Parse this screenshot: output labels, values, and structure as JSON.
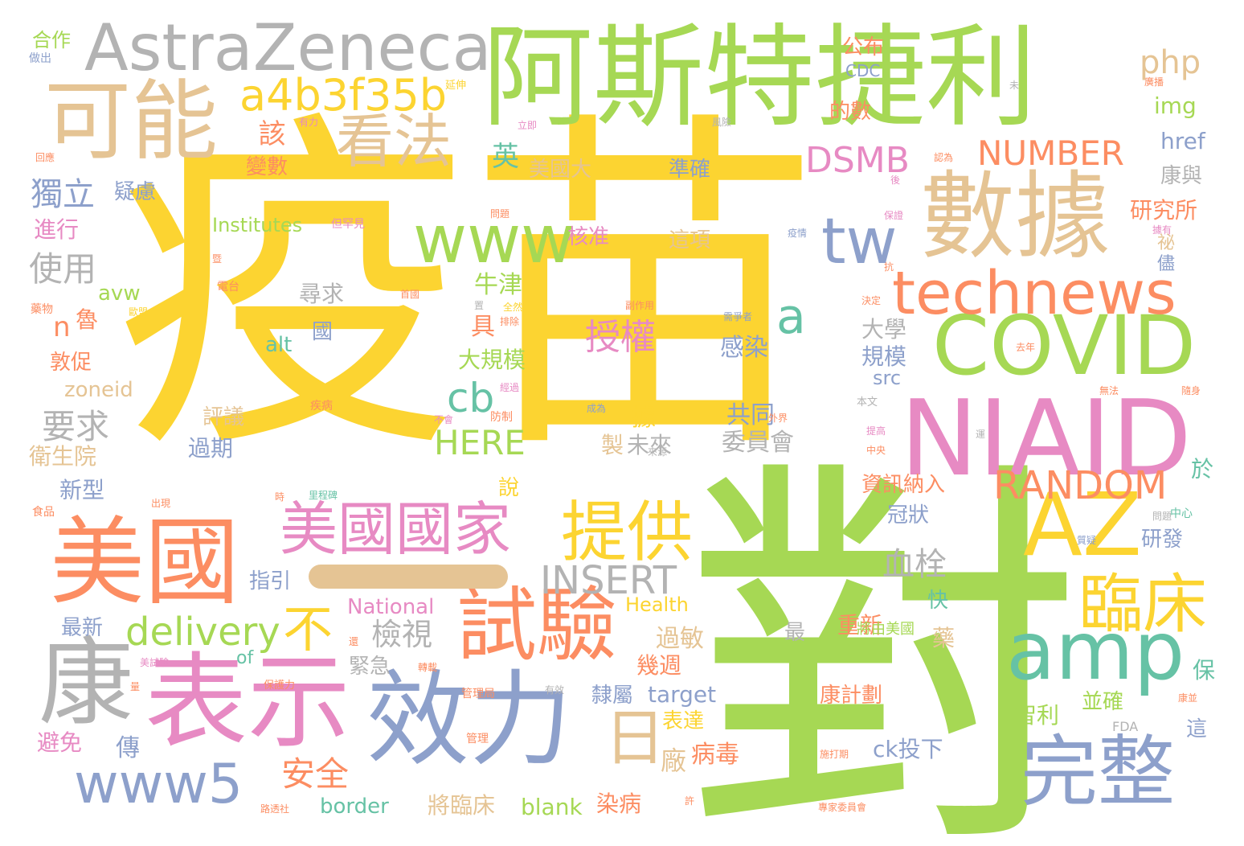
{
  "background": "#ffffff",
  "palette": {
    "yellow": "#fcd431",
    "green": "#a6d854",
    "orange": "#fc8d62",
    "blue": "#8da0cb",
    "pink": "#e78ac3",
    "tan": "#e5c494",
    "gray": "#b3b3b3",
    "teal": "#66c2a5"
  },
  "words": [
    {
      "id": "yimiao",
      "text": "疫苗",
      "color": "#fcd431"
    },
    {
      "id": "dui",
      "text": "對",
      "color": "#a6d854"
    },
    {
      "id": "astelijie",
      "text": "阿斯特捷利",
      "color": "#a6d854"
    },
    {
      "id": "astrazeneca",
      "text": "AstraZeneca",
      "color": "#b3b3b3"
    },
    {
      "id": "keneng",
      "text": "可能",
      "color": "#e5c494"
    },
    {
      "id": "kanfa",
      "text": "看法",
      "color": "#e5c494"
    },
    {
      "id": "a4b",
      "text": "a4b3f35b",
      "color": "#fcd431"
    },
    {
      "id": "shuju",
      "text": "數據",
      "color": "#e5c494"
    },
    {
      "id": "niaid",
      "text": "NIAID",
      "color": "#e78ac3"
    },
    {
      "id": "covid",
      "text": "COVID",
      "color": "#a6d854"
    },
    {
      "id": "technews",
      "text": "technews",
      "color": "#fc8d62"
    },
    {
      "id": "www",
      "text": "www",
      "color": "#a6d854"
    },
    {
      "id": "tw",
      "text": "tw",
      "color": "#8da0cb"
    },
    {
      "id": "az",
      "text": "AZ",
      "color": "#fcd431"
    },
    {
      "id": "amp",
      "text": "amp",
      "color": "#66c2a5"
    },
    {
      "id": "meiguo",
      "text": "美國",
      "color": "#fc8d62"
    },
    {
      "id": "biaoshi",
      "text": "表示",
      "color": "#e78ac3"
    },
    {
      "id": "xiaoli",
      "text": "效力",
      "color": "#8da0cb"
    },
    {
      "id": "shiyan",
      "text": "試驗",
      "color": "#fc8d62"
    },
    {
      "id": "kang",
      "text": "康",
      "color": "#b3b3b3"
    },
    {
      "id": "wanzheng",
      "text": "完整",
      "color": "#8da0cb"
    },
    {
      "id": "linchuang",
      "text": "臨床",
      "color": "#fcd431"
    },
    {
      "id": "tigong",
      "text": "提供",
      "color": "#fcd431"
    },
    {
      "id": "meiguoguojia",
      "text": "美國國家",
      "color": "#e78ac3"
    },
    {
      "id": "www5",
      "text": "www5",
      "color": "#8da0cb"
    },
    {
      "id": "ri",
      "text": "日",
      "color": "#e5c494"
    },
    {
      "id": "dsmb",
      "text": "DSMB",
      "color": "#e78ac3"
    },
    {
      "id": "number",
      "text": "NUMBER",
      "color": "#fc8d62"
    },
    {
      "id": "random",
      "text": "RANDOM",
      "color": "#fc8d62"
    },
    {
      "id": "insert",
      "text": "INSERT",
      "color": "#b3b3b3"
    },
    {
      "id": "delivery",
      "text": "delivery",
      "color": "#a6d854"
    },
    {
      "id": "here",
      "text": "HERE",
      "color": "#a6d854"
    },
    {
      "id": "php",
      "text": "php",
      "color": "#e5c494"
    },
    {
      "id": "a",
      "text": "a",
      "color": "#66c2a5"
    },
    {
      "id": "cb",
      "text": "cb",
      "color": "#66c2a5"
    },
    {
      "id": "bu",
      "text": "不",
      "color": "#fcd431"
    },
    {
      "id": "dashline",
      "text": "一",
      "color": "#e5c494"
    },
    {
      "id": "shouquan",
      "text": "授權",
      "color": "#e78ac3"
    },
    {
      "id": "duli",
      "text": "獨立",
      "color": "#8da0cb"
    },
    {
      "id": "shiyong",
      "text": "使用",
      "color": "#b3b3b3"
    },
    {
      "id": "yaoqiu",
      "text": "要求",
      "color": "#b3b3b3"
    },
    {
      "id": "jianshi",
      "text": "檢視",
      "color": "#b3b3b3"
    },
    {
      "id": "anquan",
      "text": "安全",
      "color": "#fc8d62"
    },
    {
      "id": "xueshuan",
      "text": "血栓",
      "color": "#b3b3b3"
    },
    {
      "id": "gai",
      "text": "該",
      "color": "#fc8d62"
    },
    {
      "id": "yilv",
      "text": "疑慮",
      "color": "#8da0cb"
    },
    {
      "id": "jinxing",
      "text": "進行",
      "color": "#e78ac3"
    },
    {
      "id": "bianshu",
      "text": "變數",
      "color": "#fc8d62"
    },
    {
      "id": "meiguoda",
      "text": "美國大",
      "color": "#e5c494"
    },
    {
      "id": "ying",
      "text": "英",
      "color": "#66c2a5"
    },
    {
      "id": "zhunque",
      "text": "準確",
      "color": "#8da0cb"
    },
    {
      "id": "zhexiang",
      "text": "這項",
      "color": "#e5c494"
    },
    {
      "id": "hezhun",
      "text": "核准",
      "color": "#e78ac3"
    },
    {
      "id": "niujin",
      "text": "牛津",
      "color": "#a6d854"
    },
    {
      "id": "xunqiu",
      "text": "尋求",
      "color": "#b3b3b3"
    },
    {
      "id": "daxue",
      "text": "大學",
      "color": "#b3b3b3"
    },
    {
      "id": "guimo",
      "text": "規模",
      "color": "#8da0cb"
    },
    {
      "id": "daguimo",
      "text": "大規模",
      "color": "#a6d854"
    },
    {
      "id": "ganran",
      "text": "感染",
      "color": "#8da0cb"
    },
    {
      "id": "gongtong",
      "text": "共同",
      "color": "#8da0cb"
    },
    {
      "id": "weiyuanhui",
      "text": "委員會",
      "color": "#b3b3b3"
    },
    {
      "id": "weilai",
      "text": "未來",
      "color": "#b3b3b3"
    },
    {
      "id": "zhi",
      "text": "製",
      "color": "#e5c494"
    },
    {
      "id": "ju",
      "text": "據",
      "color": "#fcd431"
    },
    {
      "id": "guoqi",
      "text": "過期",
      "color": "#8da0cb"
    },
    {
      "id": "pingyi",
      "text": "評議",
      "color": "#e5c494"
    },
    {
      "id": "xinxing",
      "text": "新型",
      "color": "#8da0cb"
    },
    {
      "id": "weishengyuan",
      "text": "衛生院",
      "color": "#e5c494"
    },
    {
      "id": "zhiyin",
      "text": "指引",
      "color": "#8da0cb"
    },
    {
      "id": "zuixin",
      "text": "最新",
      "color": "#8da0cb"
    },
    {
      "id": "bimian",
      "text": "避免",
      "color": "#e78ac3"
    },
    {
      "id": "zhuan",
      "text": "傳",
      "color": "#8da0cb"
    },
    {
      "id": "jinji",
      "text": "緊急",
      "color": "#b3b3b3"
    },
    {
      "id": "guomin",
      "text": "過敏",
      "color": "#e5c494"
    },
    {
      "id": "jizhou",
      "text": "幾週",
      "color": "#fc8d62"
    },
    {
      "id": "lishu",
      "text": "隸屬",
      "color": "#8da0cb"
    },
    {
      "id": "biaoda",
      "text": "表達",
      "color": "#fcd431"
    },
    {
      "id": "chang",
      "text": "廠",
      "color": "#e5c494"
    },
    {
      "id": "bingdu",
      "text": "病毒",
      "color": "#fc8d62"
    },
    {
      "id": "ranbing",
      "text": "染病",
      "color": "#fc8d62"
    },
    {
      "id": "jianglinchuang",
      "text": "將臨床",
      "color": "#e5c494"
    },
    {
      "id": "border",
      "text": "border",
      "color": "#66c2a5"
    },
    {
      "id": "blank",
      "text": "blank",
      "color": "#a6d854"
    },
    {
      "id": "target",
      "text": "target",
      "color": "#8da0cb"
    },
    {
      "id": "cktouxia",
      "text": "ck投下",
      "color": "#8da0cb"
    },
    {
      "id": "kangjihua",
      "text": "康計劃",
      "color": "#fc8d62"
    },
    {
      "id": "zhongxin",
      "text": "重新",
      "color": "#fc8d62"
    },
    {
      "id": "zhili",
      "text": "智利",
      "color": "#a6d854"
    },
    {
      "id": "bingque",
      "text": "並確",
      "color": "#a6d854"
    },
    {
      "id": "yanfa",
      "text": "研發",
      "color": "#8da0cb"
    },
    {
      "id": "guanzhuang",
      "text": "冠狀",
      "color": "#8da0cb"
    },
    {
      "id": "zixun",
      "text": "資訊納入",
      "color": "#fc8d62"
    },
    {
      "id": "yanjiusuo",
      "text": "研究所",
      "color": "#fc8d62"
    },
    {
      "id": "kangyu",
      "text": "康與",
      "color": "#b3b3b3"
    },
    {
      "id": "href",
      "text": "href",
      "color": "#8da0cb"
    },
    {
      "id": "img",
      "text": "img",
      "color": "#a6d854"
    },
    {
      "id": "cdc",
      "text": "CDC",
      "color": "#8da0cb"
    },
    {
      "id": "gongbu",
      "text": "公布",
      "color": "#fc8d62"
    },
    {
      "id": "deshu",
      "text": "的數",
      "color": "#fc8d62"
    },
    {
      "id": "institutes",
      "text": "Institutes",
      "color": "#a6d854"
    },
    {
      "id": "national",
      "text": "National",
      "color": "#e78ac3"
    },
    {
      "id": "health",
      "text": "Health",
      "color": "#fcd431"
    },
    {
      "id": "zoneid",
      "text": "zoneid",
      "color": "#e5c494"
    },
    {
      "id": "avw",
      "text": "avw",
      "color": "#a6d854"
    },
    {
      "id": "alt",
      "text": "alt",
      "color": "#66c2a5"
    },
    {
      "id": "src",
      "text": "src",
      "color": "#8da0cb"
    },
    {
      "id": "of",
      "text": "of",
      "color": "#66c2a5"
    },
    {
      "id": "n",
      "text": "n",
      "color": "#fc8d62"
    },
    {
      "id": "lu",
      "text": "魯",
      "color": "#fc8d62"
    },
    {
      "id": "jucu",
      "text": "敦促",
      "color": "#fc8d62"
    },
    {
      "id": "juyou",
      "text": "具",
      "color": "#fc8d62"
    },
    {
      "id": "guo",
      "text": "國",
      "color": "#8da0cb"
    },
    {
      "id": "shuo",
      "text": "說",
      "color": "#fcd431"
    },
    {
      "id": "kuai",
      "text": "快",
      "color": "#66c2a5"
    },
    {
      "id": "yao",
      "text": "藥",
      "color": "#e5c494"
    },
    {
      "id": "zui",
      "text": "最",
      "color": "#b3b3b3"
    },
    {
      "id": "yu",
      "text": "於",
      "color": "#66c2a5"
    },
    {
      "id": "bao",
      "text": "保",
      "color": "#66c2a5"
    },
    {
      "id": "zhe",
      "text": "這",
      "color": "#8da0cb"
    },
    {
      "id": "hezuo",
      "text": "合作",
      "color": "#a6d854"
    },
    {
      "id": "zuochu",
      "text": "做出",
      "color": "#8da0cb"
    },
    {
      "id": "mi",
      "text": "祕",
      "color": "#e5c494"
    },
    {
      "id": "jin",
      "text": "儘",
      "color": "#8da0cb"
    },
    {
      "id": "fda",
      "text": "FDA",
      "color": "#b3b3b3"
    },
    {
      "id": "jiangyoumeiguo",
      "text": "將由美國",
      "color": "#a6d854"
    },
    {
      "id": "yanshen",
      "text": "延伸",
      "color": "#fcd431"
    },
    {
      "id": "youli",
      "text": "有力",
      "color": "#e78ac3"
    },
    {
      "id": "huiying",
      "text": "回應",
      "color": "#fc8d62"
    },
    {
      "id": "renwei",
      "text": "認為",
      "color": "#fc8d62"
    },
    {
      "id": "lijii",
      "text": "立即",
      "color": "#e78ac3"
    },
    {
      "id": "fengxian",
      "text": "風險",
      "color": "#b3b3b3"
    },
    {
      "id": "danqiejian",
      "text": "但罕見",
      "color": "#e78ac3"
    },
    {
      "id": "wenti",
      "text": "問題",
      "color": "#fc8d62"
    },
    {
      "id": "yiqing",
      "text": "疫情",
      "color": "#8da0cb"
    },
    {
      "id": "baozheng",
      "text": "保證",
      "color": "#e78ac3"
    },
    {
      "id": "ju2",
      "text": "據有",
      "color": "#e78ac3"
    },
    {
      "id": "diantai",
      "text": "電台",
      "color": "#fc8d62"
    },
    {
      "id": "yaowu",
      "text": "藥物",
      "color": "#fc8d62"
    },
    {
      "id": "oumeng",
      "text": "歐盟",
      "color": "#fcd431"
    },
    {
      "id": "shouguo",
      "text": "首國",
      "color": "#fc8d62"
    },
    {
      "id": "quanran",
      "text": "全然",
      "color": "#fcd431"
    },
    {
      "id": "paichu",
      "text": "排除",
      "color": "#fc8d62"
    },
    {
      "id": "fuzuoyong",
      "text": "副作用",
      "color": "#fc8d62"
    },
    {
      "id": "xuyaozhe",
      "text": "需爭者",
      "color": "#8da0cb"
    },
    {
      "id": "jueding",
      "text": "決定",
      "color": "#fc8d62"
    },
    {
      "id": "qunian",
      "text": "去年",
      "color": "#fc8d62"
    },
    {
      "id": "wufa",
      "text": "無法",
      "color": "#fc8d62"
    },
    {
      "id": "suishen",
      "text": "隨身",
      "color": "#fc8d62"
    },
    {
      "id": "benwen",
      "text": "本文",
      "color": "#b3b3b3"
    },
    {
      "id": "tigao",
      "text": "提高",
      "color": "#e78ac3"
    },
    {
      "id": "zhongyang",
      "text": "中央",
      "color": "#fc8d62"
    },
    {
      "id": "jibing",
      "text": "疾病",
      "color": "#fc8d62"
    },
    {
      "id": "fangzhi",
      "text": "防制",
      "color": "#fc8d62"
    },
    {
      "id": "buhui",
      "text": "不會",
      "color": "#e78ac3"
    },
    {
      "id": "jingguo",
      "text": "經過",
      "color": "#e78ac3"
    },
    {
      "id": "chengwei",
      "text": "成為",
      "color": "#8da0cb"
    },
    {
      "id": "laiyuan",
      "text": "來源",
      "color": "#b3b3b3"
    },
    {
      "id": "waijie",
      "text": "外界",
      "color": "#fc8d62"
    },
    {
      "id": "shipin",
      "text": "食品",
      "color": "#fc8d62"
    },
    {
      "id": "chuxian",
      "text": "出現",
      "color": "#fc8d62"
    },
    {
      "id": "shi",
      "text": "時",
      "color": "#fc8d62"
    },
    {
      "id": "lichengbei",
      "text": "里程碑",
      "color": "#66c2a5"
    },
    {
      "id": "meishiyan",
      "text": "美試驗",
      "color": "#e78ac3"
    },
    {
      "id": "zhuanzai",
      "text": "轉載",
      "color": "#fc8d62"
    },
    {
      "id": "liang",
      "text": "量",
      "color": "#fc8d62"
    },
    {
      "id": "baohuli",
      "text": "保護力",
      "color": "#fc8d62"
    },
    {
      "id": "guanliju",
      "text": "管理局",
      "color": "#fc8d62"
    },
    {
      "id": "youxiao",
      "text": "有效",
      "color": "#b3b3b3"
    },
    {
      "id": "guanli",
      "text": "管理",
      "color": "#fc8d62"
    },
    {
      "id": "lutoushe",
      "text": "路透社",
      "color": "#fc8d62"
    },
    {
      "id": "xu",
      "text": "許",
      "color": "#fc8d62"
    },
    {
      "id": "shidazi",
      "text": "施打期",
      "color": "#fc8d62"
    },
    {
      "id": "zhuanjia",
      "text": "專家委員會",
      "color": "#fc8d62"
    },
    {
      "id": "wenti2",
      "text": "問題",
      "color": "#b3b3b3"
    },
    {
      "id": "zhiyi",
      "text": "質疑",
      "color": "#8da0cb"
    },
    {
      "id": "zhongxin2",
      "text": "中心",
      "color": "#66c2a5"
    },
    {
      "id": "kangbing",
      "text": "康並",
      "color": "#fc8d62"
    },
    {
      "id": "guangbo",
      "text": "廣播",
      "color": "#fc8d62"
    },
    {
      "id": "wei",
      "text": "未",
      "color": "#b3b3b3"
    },
    {
      "id": "hou",
      "text": "後",
      "color": "#e78ac3"
    },
    {
      "id": "kang2",
      "text": "抗",
      "color": "#fc8d62"
    },
    {
      "id": "zhi2",
      "text": "置",
      "color": "#b3b3b3"
    },
    {
      "id": "huan",
      "text": "還",
      "color": "#fc8d62"
    },
    {
      "id": "dui2",
      "text": "暨",
      "color": "#fc8d62"
    },
    {
      "id": "yun",
      "text": "運",
      "color": "#b3b3b3"
    }
  ]
}
